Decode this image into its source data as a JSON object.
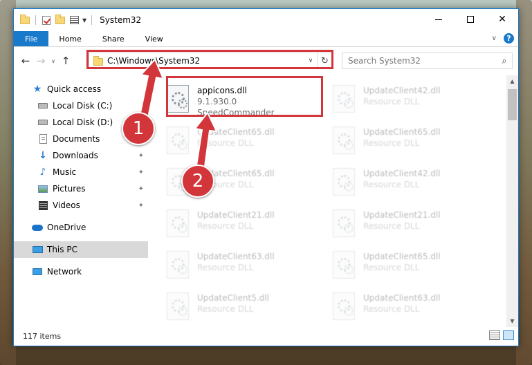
{
  "window": {
    "title": "System32",
    "controls": {
      "minimize": "—",
      "maximize": "",
      "close": "✕"
    }
  },
  "ribbon": {
    "tabs": [
      "File",
      "Home",
      "Share",
      "View"
    ],
    "chevron": "∨",
    "help": "?"
  },
  "navigation": {
    "back": "←",
    "forward": "→",
    "recent": "∨",
    "up": "↑",
    "address": "C:\\Windows\\System32",
    "address_dropdown": "∨",
    "refresh": "↻",
    "search_placeholder": "Search System32",
    "search_glyph": "⌕"
  },
  "sidebar": {
    "items": [
      {
        "label": "Quick access",
        "icon": "quick-access-star-icon",
        "pinned": false
      },
      {
        "label": "Local Disk (C:)",
        "icon": "drive-icon",
        "pinned": false
      },
      {
        "label": "Local Disk (D:)",
        "icon": "drive-icon",
        "pinned": false
      },
      {
        "label": "Documents",
        "icon": "documents-icon",
        "pinned": false
      },
      {
        "label": "Downloads",
        "icon": "download-icon",
        "pinned": true
      },
      {
        "label": "Music",
        "icon": "music-icon",
        "pinned": true
      },
      {
        "label": "Pictures",
        "icon": "pictures-icon",
        "pinned": true
      },
      {
        "label": "Videos",
        "icon": "videos-icon",
        "pinned": true
      },
      {
        "label": "OneDrive",
        "icon": "onedrive-cloud-icon",
        "pinned": false
      },
      {
        "label": "This PC",
        "icon": "this-pc-icon",
        "pinned": false,
        "selected": true
      },
      {
        "label": "Network",
        "icon": "network-icon",
        "pinned": false
      }
    ],
    "pin_glyph": "📌"
  },
  "files": [
    {
      "name": "appicons.dll",
      "line2": "9.1.930.0",
      "line3": "SpeedCommander",
      "selected": true
    },
    {
      "name": "UpdateClient42.dll",
      "line2": "Resource DLL",
      "line3": ""
    },
    {
      "name": "UpdateClient65.dll",
      "line2": "Resource DLL",
      "line3": ""
    },
    {
      "name": "UpdateClient65.dll",
      "line2": "Resource DLL",
      "line3": ""
    },
    {
      "name": "UpdateClient65.dll",
      "line2": "Resource DLL",
      "line3": ""
    },
    {
      "name": "UpdateClient42.dll",
      "line2": "Resource DLL",
      "line3": ""
    },
    {
      "name": "UpdateClient21.dll",
      "line2": "Resource DLL",
      "line3": ""
    },
    {
      "name": "UpdateClient21.dll",
      "line2": "Resource DLL",
      "line3": ""
    },
    {
      "name": "UpdateClient63.dll",
      "line2": "Resource DLL",
      "line3": ""
    },
    {
      "name": "UpdateClient65.dll",
      "line2": "Resource DLL",
      "line3": ""
    },
    {
      "name": "UpdateClient5.dll",
      "line2": "Resource DLL",
      "line3": ""
    },
    {
      "name": "UpdateClient63.dll",
      "line2": "Resource DLL",
      "line3": ""
    }
  ],
  "status": {
    "count": "117 items"
  },
  "annotations": {
    "marker1": "1",
    "marker2": "2",
    "color": "#d2353a"
  }
}
